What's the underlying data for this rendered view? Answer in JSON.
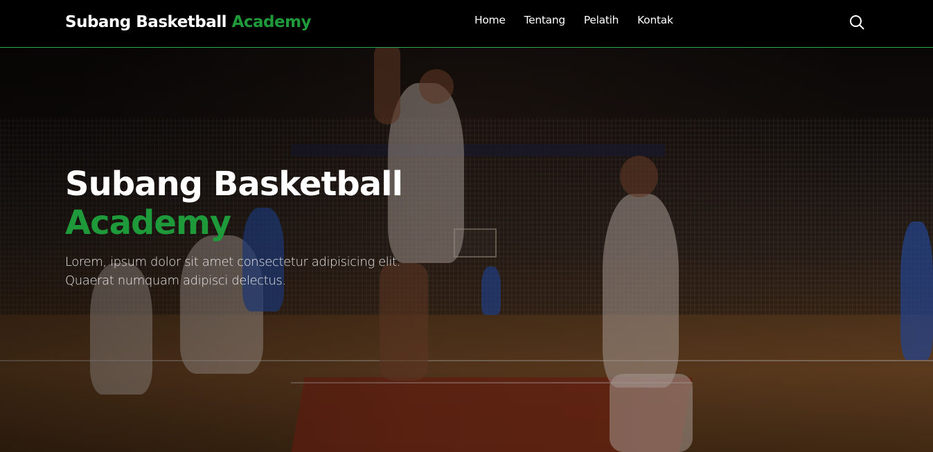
{
  "navbar": {
    "brand_main": "Subang Basketball",
    "brand_accent": "Academy",
    "links": [
      {
        "label": "Home"
      },
      {
        "label": "Tentang"
      },
      {
        "label": "Pelatih"
      },
      {
        "label": "Kontak"
      }
    ],
    "search_icon": "search-icon"
  },
  "hero": {
    "title_main": "Subang Basketball",
    "title_accent": "Academy",
    "description": "Lorem, ipsum dolor sit amet consectetur adipisicing elit. Quaerat numquam adipisci delectus.",
    "background_image": "basketball-arena-photo"
  },
  "colors": {
    "accent": "#1e9a3a",
    "navbar_bg": "#000000",
    "navbar_border": "#2fa84f",
    "text": "#ffffff"
  }
}
